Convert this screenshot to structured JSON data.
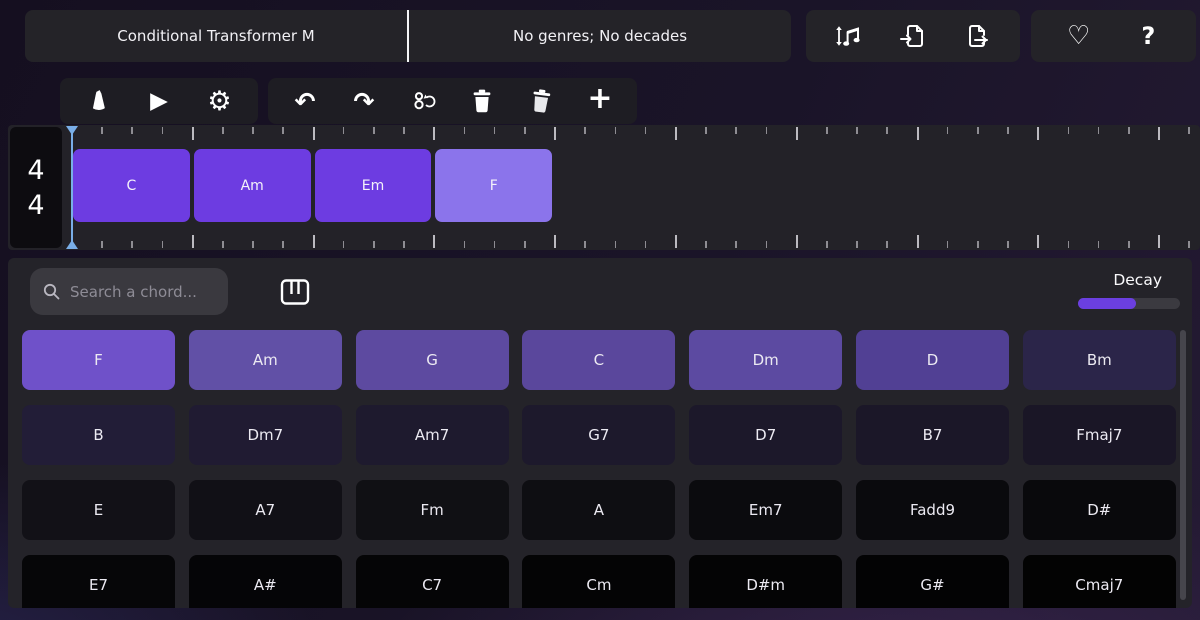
{
  "header": {
    "model_label": "Conditional Transformer M",
    "filters_label": "No genres; No decades",
    "transpose_icon": "transpose-notes",
    "import_icon": "import-file",
    "export_icon": "export-file",
    "favorite_icon": "♡",
    "help_icon": "?"
  },
  "toolbar": {
    "metronome_icon": "metronome",
    "play_icon": "▶",
    "settings_icon": "⚙",
    "undo_icon": "↶",
    "redo_icon": "↷",
    "regenerate_icon": "regenerate-voicings",
    "delete_icon": "trash",
    "delete_all_icon": "trash-filled",
    "add_label": "+"
  },
  "timeline": {
    "time_signature": {
      "top": "4",
      "bottom": "4"
    },
    "beat_width": 30.2,
    "beats_per_bar": 4,
    "tick_count": 38,
    "playhead_color": "#79aee7",
    "chords": [
      {
        "label": "C",
        "bar": 0,
        "color": "#6d3ce1"
      },
      {
        "label": "Am",
        "bar": 1,
        "color": "#6d3ce1"
      },
      {
        "label": "Em",
        "bar": 2,
        "color": "#6d3ce1"
      },
      {
        "label": "F",
        "bar": 3,
        "color": "#8b74eb"
      }
    ]
  },
  "chord_panel": {
    "search_placeholder": "Search a chord...",
    "search_value": "",
    "piano_icon": "piano-keys",
    "decay": {
      "label": "Decay",
      "value_pct": 57,
      "fill_color": "#6b3fe0",
      "track_color": "#3b3a40"
    },
    "grid": [
      [
        {
          "label": "F",
          "color": "#6f51c9"
        },
        {
          "label": "Am",
          "color": "#6150a6"
        },
        {
          "label": "G",
          "color": "#5d4aa0"
        },
        {
          "label": "C",
          "color": "#5a479c"
        },
        {
          "label": "Dm",
          "color": "#5c4aa1"
        },
        {
          "label": "D",
          "color": "#514094"
        },
        {
          "label": "Bm",
          "color": "#2b2549"
        }
      ],
      [
        {
          "label": "B",
          "color": "#221d37"
        },
        {
          "label": "Dm7",
          "color": "#201b32"
        },
        {
          "label": "Am7",
          "color": "#1e1a2e"
        },
        {
          "label": "G7",
          "color": "#1d192c"
        },
        {
          "label": "D7",
          "color": "#1c182a"
        },
        {
          "label": "B7",
          "color": "#1b1728"
        },
        {
          "label": "Fmaj7",
          "color": "#1a1626"
        }
      ],
      [
        {
          "label": "E",
          "color": "#121117"
        },
        {
          "label": "A7",
          "color": "#111016"
        },
        {
          "label": "Fm",
          "color": "#101014"
        },
        {
          "label": "A",
          "color": "#0e0e12"
        },
        {
          "label": "Em7",
          "color": "#0b0b0e"
        },
        {
          "label": "Fadd9",
          "color": "#0a0a0d"
        },
        {
          "label": "D#",
          "color": "#09090c"
        }
      ],
      [
        {
          "label": "E7",
          "color": "#060608"
        },
        {
          "label": "A#",
          "color": "#050507"
        },
        {
          "label": "C7",
          "color": "#050506"
        },
        {
          "label": "Cm",
          "color": "#040405"
        },
        {
          "label": "D#m",
          "color": "#040405"
        },
        {
          "label": "G#",
          "color": "#030304"
        },
        {
          "label": "Cmaj7",
          "color": "#030303"
        }
      ]
    ]
  }
}
